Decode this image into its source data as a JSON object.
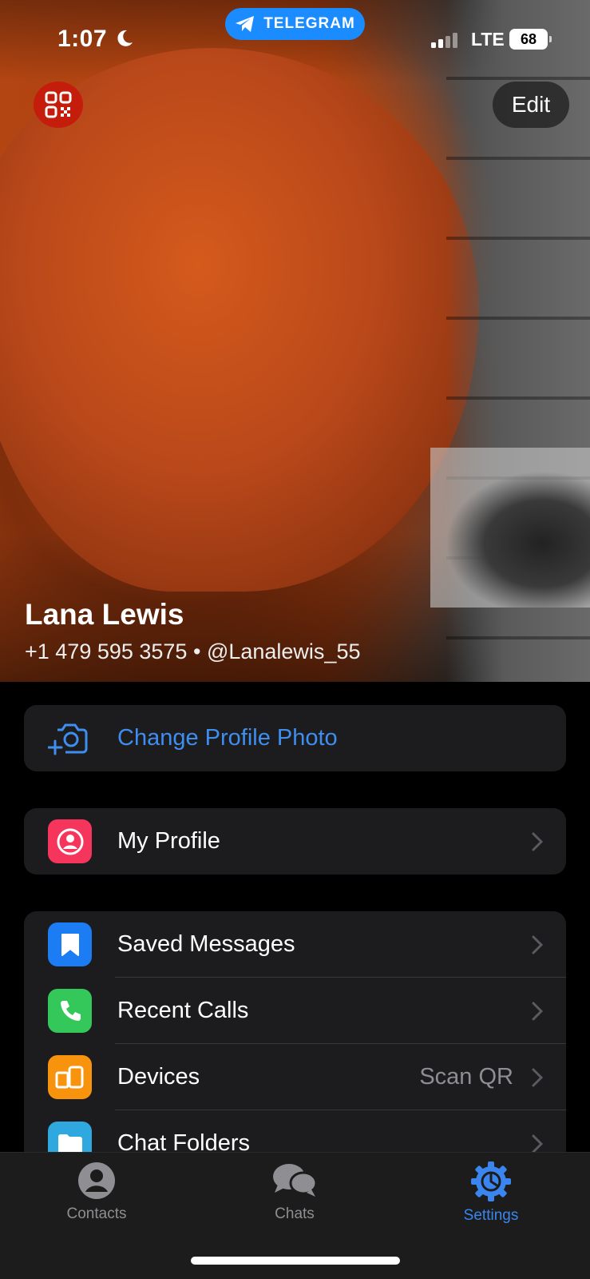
{
  "status_bar": {
    "time": "1:07",
    "app_pill": "TELEGRAM",
    "network": "LTE",
    "battery": "68"
  },
  "header": {
    "edit_label": "Edit",
    "name": "Lana Lewis",
    "phone": "+1 479 595 3575",
    "separator": "•",
    "username": "@Lanalewis_55"
  },
  "actions": {
    "change_photo": "Change Profile Photo"
  },
  "profile_section": {
    "my_profile": "My Profile"
  },
  "menu": [
    {
      "label": "Saved Messages",
      "value": "",
      "icon": "bookmark-icon",
      "color": "#1c7cf4"
    },
    {
      "label": "Recent Calls",
      "value": "",
      "icon": "phone-icon",
      "color": "#34c759"
    },
    {
      "label": "Devices",
      "value": "Scan QR",
      "icon": "devices-icon",
      "color": "#f7930d"
    },
    {
      "label": "Chat Folders",
      "value": "",
      "icon": "folder-icon",
      "color": "#2fa8df"
    }
  ],
  "tabs": [
    {
      "label": "Contacts",
      "active": false
    },
    {
      "label": "Chats",
      "active": false
    },
    {
      "label": "Settings",
      "active": true
    }
  ],
  "colors": {
    "accent": "#3a86ee",
    "qr_button": "#c51d0b",
    "my_profile_icon": "#f5355b"
  }
}
